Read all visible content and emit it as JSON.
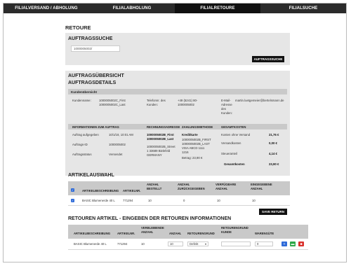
{
  "nav": {
    "tabs": [
      {
        "label": "FILIALVERSAND / ABHOLUNG"
      },
      {
        "label": "FILIALABHOLUNG"
      },
      {
        "label": "FILIALRETOURE"
      },
      {
        "label": "FILIALSUCHE"
      }
    ],
    "active_index": 2
  },
  "page_title": "RETOURE",
  "search": {
    "heading": "AUFTRAGSSUCHE",
    "value": "1000005002/",
    "button_label": "AUFTRAGSSUCHE"
  },
  "overview": {
    "heading": "AUFTRAGSÜBERSICHT",
    "subheading": "AUFTRAGSDETAILS",
    "customer_bar": "Kundenübersicht",
    "customer": {
      "name_label": "Kundenname:",
      "name_value_1": "1000005002C_First",
      "name_value_2": "1000005002C_Last",
      "phone_label_1": "Telefonnr. des",
      "phone_label_2": "Kunden:",
      "phone_value_1": "+49 (5241) 80-",
      "phone_value_2": "1000005002",
      "email_label_1": "E-Mail-",
      "email_label_2": "Adresse",
      "email_label_3": "des",
      "email_label_4": "Kunden:",
      "email_value": "martin.luetgemeier@bertelsmann.de"
    },
    "order_headers": [
      "INFORMATIONEN ZUM AUFTRAG",
      "RECHNUNGSADRESSE",
      "ZAHLUNGSMETHODE",
      "GESAMTKOSTEN"
    ],
    "order": {
      "placed_label": "Auftrag aufgegeben",
      "placed_value": "10/1/18, 10:01 AM",
      "id_label": "Auftrags-ID",
      "id_value": "1000005002",
      "status_label": "Auftragsstatus",
      "status_value": "Versendet",
      "billing_name_1": "1000005002B_First",
      "billing_name_2": "1000005002B_Last",
      "billing_street": "1000005002B_Street",
      "billing_city": "1 33689 Bielefeld",
      "billing_country": "GERMANY",
      "payment_method": "Kreditkarte",
      "payment_name_1": "1000005002B_FIRST",
      "payment_name_2": "1000005002B_LAST",
      "payment_card_1": "VISA ABCD 1111",
      "payment_card_2": "1216",
      "payment_amount": "Betrag: 23,90 €",
      "cost_label_1": "Kosten ohne Versand",
      "cost_value_1": "21,76 €",
      "cost_label_2": "Versandkosten",
      "cost_value_2": "0,00 €",
      "cost_label_3": "Steueranteil",
      "cost_value_3": "4,14 €",
      "cost_label_4": "Gesamtkosten",
      "cost_value_4": "23,90 €"
    }
  },
  "articles": {
    "heading": "ARTIKELAUSWAHL",
    "headers": [
      "ARTIKELBESCHREIBUNG",
      "ARTIKELNR.",
      "ANZAHL BESTELLT",
      "ANZAHL ZURÜCKGEGEBEN",
      "VERFÜGBARE ANZAHL",
      "EINGEGEBENE ANZAHL"
    ],
    "rows": [
      {
        "desc": "BASIC Blumenerde 40 L",
        "nr": "771294",
        "ordered": "10",
        "returned": "0",
        "available": "10",
        "entered": "10"
      }
    ],
    "save_label": "SAVE RETURN"
  },
  "returns": {
    "heading": "RETOUREN ARTIKEL - EINGEBEN DER RETOUREN INFORMATIONEN",
    "headers": [
      "ARTIKELBESCHREIBUNG",
      "ARTIKELNR.",
      "VERBLEIBENDE ANZAHL",
      "ANZAHL",
      "RETOURENGRUND",
      "RETOURENGRUND KUNDE",
      "WARENGÜTE"
    ],
    "rows": [
      {
        "desc": "BASIC Blumenerde 40 L",
        "nr": "771294",
        "remaining": "10",
        "qty": "10",
        "reason": "Defekt",
        "customer_reason": "",
        "quality": "0"
      }
    ]
  },
  "colors": {
    "nav_bg": "#2b2b2b",
    "panel_bg": "#e6e6e6",
    "header_bg": "#c9c9c9",
    "blue": "#2f6bd8",
    "green": "#2ea84a",
    "red": "#d9302c"
  }
}
